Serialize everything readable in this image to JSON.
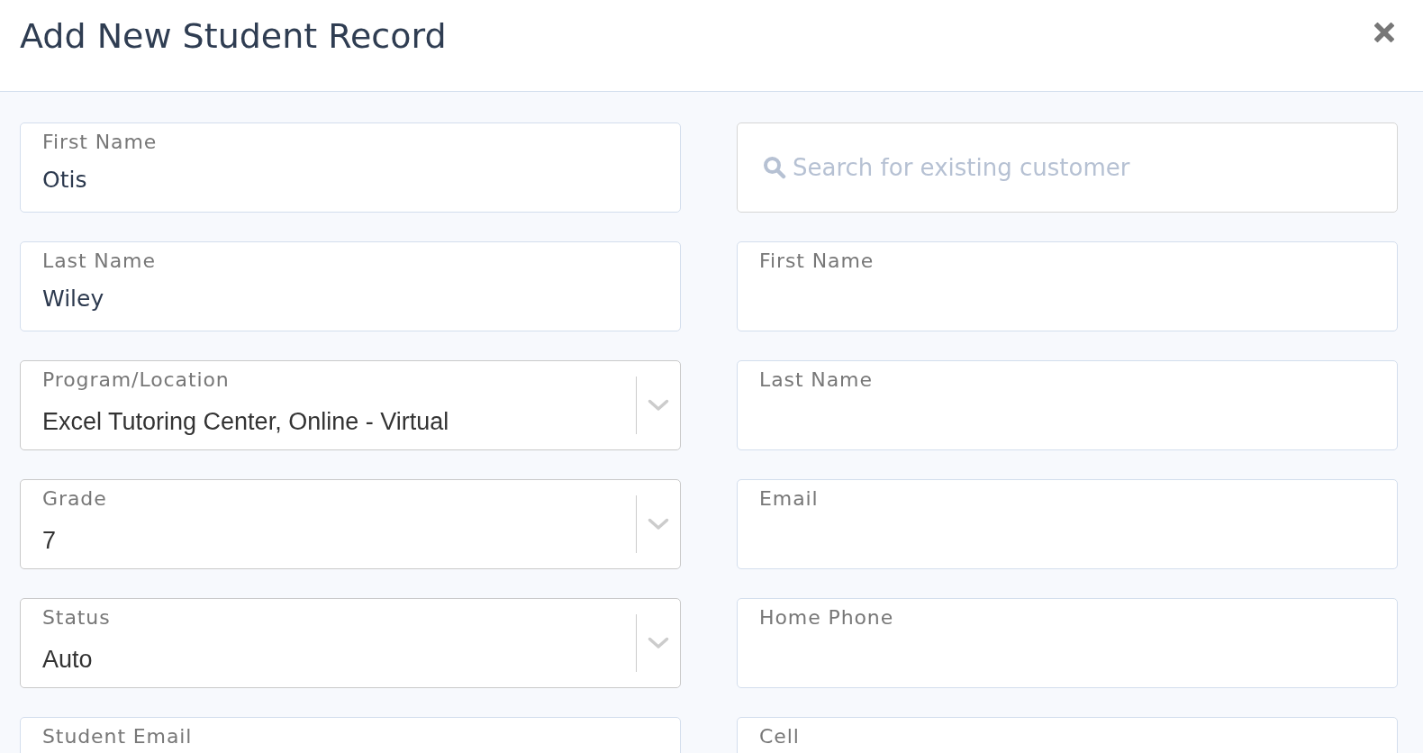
{
  "dialog": {
    "title": "Add New Student Record"
  },
  "student_fields": [
    {
      "kind": "text",
      "label": "First Name",
      "value": "Otis"
    },
    {
      "kind": "text",
      "label": "Last Name",
      "value": "Wiley"
    },
    {
      "kind": "select",
      "label": "Program/Location",
      "value": "Excel Tutoring Center, Online - Virtual"
    },
    {
      "kind": "select",
      "label": "Grade",
      "value": "7"
    },
    {
      "kind": "select",
      "label": "Status",
      "value": "Auto"
    },
    {
      "kind": "text",
      "label": "Student Email"
    }
  ],
  "customer_search": {
    "placeholder": "Search for existing customer"
  },
  "customer_fields": [
    {
      "kind": "text",
      "label": "First Name"
    },
    {
      "kind": "text",
      "label": "Last Name"
    },
    {
      "kind": "text",
      "label": "Email"
    },
    {
      "kind": "text",
      "label": "Home Phone"
    },
    {
      "kind": "text",
      "label": "Cell"
    }
  ]
}
